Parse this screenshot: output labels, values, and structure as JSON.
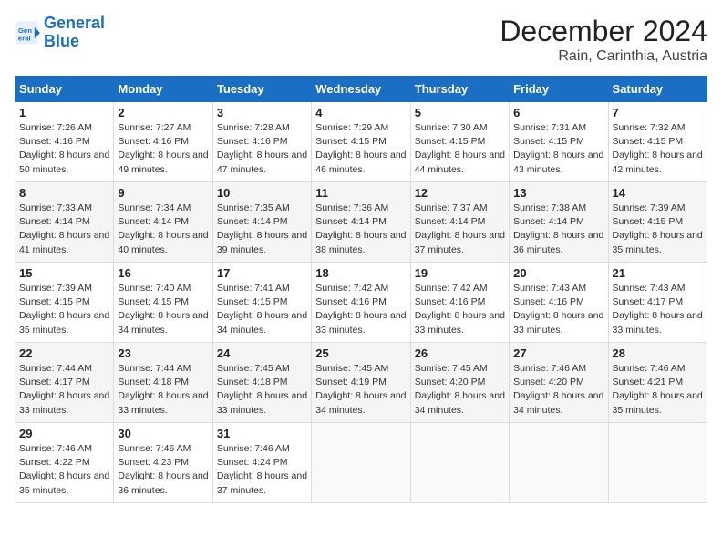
{
  "header": {
    "logo_line1": "General",
    "logo_line2": "Blue",
    "title": "December 2024",
    "subtitle": "Rain, Carinthia, Austria"
  },
  "weekdays": [
    "Sunday",
    "Monday",
    "Tuesday",
    "Wednesday",
    "Thursday",
    "Friday",
    "Saturday"
  ],
  "weeks": [
    [
      {
        "day": "1",
        "sunrise": "Sunrise: 7:26 AM",
        "sunset": "Sunset: 4:16 PM",
        "daylight": "Daylight: 8 hours and 50 minutes."
      },
      {
        "day": "2",
        "sunrise": "Sunrise: 7:27 AM",
        "sunset": "Sunset: 4:16 PM",
        "daylight": "Daylight: 8 hours and 49 minutes."
      },
      {
        "day": "3",
        "sunrise": "Sunrise: 7:28 AM",
        "sunset": "Sunset: 4:16 PM",
        "daylight": "Daylight: 8 hours and 47 minutes."
      },
      {
        "day": "4",
        "sunrise": "Sunrise: 7:29 AM",
        "sunset": "Sunset: 4:15 PM",
        "daylight": "Daylight: 8 hours and 46 minutes."
      },
      {
        "day": "5",
        "sunrise": "Sunrise: 7:30 AM",
        "sunset": "Sunset: 4:15 PM",
        "daylight": "Daylight: 8 hours and 44 minutes."
      },
      {
        "day": "6",
        "sunrise": "Sunrise: 7:31 AM",
        "sunset": "Sunset: 4:15 PM",
        "daylight": "Daylight: 8 hours and 43 minutes."
      },
      {
        "day": "7",
        "sunrise": "Sunrise: 7:32 AM",
        "sunset": "Sunset: 4:15 PM",
        "daylight": "Daylight: 8 hours and 42 minutes."
      }
    ],
    [
      {
        "day": "8",
        "sunrise": "Sunrise: 7:33 AM",
        "sunset": "Sunset: 4:14 PM",
        "daylight": "Daylight: 8 hours and 41 minutes."
      },
      {
        "day": "9",
        "sunrise": "Sunrise: 7:34 AM",
        "sunset": "Sunset: 4:14 PM",
        "daylight": "Daylight: 8 hours and 40 minutes."
      },
      {
        "day": "10",
        "sunrise": "Sunrise: 7:35 AM",
        "sunset": "Sunset: 4:14 PM",
        "daylight": "Daylight: 8 hours and 39 minutes."
      },
      {
        "day": "11",
        "sunrise": "Sunrise: 7:36 AM",
        "sunset": "Sunset: 4:14 PM",
        "daylight": "Daylight: 8 hours and 38 minutes."
      },
      {
        "day": "12",
        "sunrise": "Sunrise: 7:37 AM",
        "sunset": "Sunset: 4:14 PM",
        "daylight": "Daylight: 8 hours and 37 minutes."
      },
      {
        "day": "13",
        "sunrise": "Sunrise: 7:38 AM",
        "sunset": "Sunset: 4:14 PM",
        "daylight": "Daylight: 8 hours and 36 minutes."
      },
      {
        "day": "14",
        "sunrise": "Sunrise: 7:39 AM",
        "sunset": "Sunset: 4:15 PM",
        "daylight": "Daylight: 8 hours and 35 minutes."
      }
    ],
    [
      {
        "day": "15",
        "sunrise": "Sunrise: 7:39 AM",
        "sunset": "Sunset: 4:15 PM",
        "daylight": "Daylight: 8 hours and 35 minutes."
      },
      {
        "day": "16",
        "sunrise": "Sunrise: 7:40 AM",
        "sunset": "Sunset: 4:15 PM",
        "daylight": "Daylight: 8 hours and 34 minutes."
      },
      {
        "day": "17",
        "sunrise": "Sunrise: 7:41 AM",
        "sunset": "Sunset: 4:15 PM",
        "daylight": "Daylight: 8 hours and 34 minutes."
      },
      {
        "day": "18",
        "sunrise": "Sunrise: 7:42 AM",
        "sunset": "Sunset: 4:16 PM",
        "daylight": "Daylight: 8 hours and 33 minutes."
      },
      {
        "day": "19",
        "sunrise": "Sunrise: 7:42 AM",
        "sunset": "Sunset: 4:16 PM",
        "daylight": "Daylight: 8 hours and 33 minutes."
      },
      {
        "day": "20",
        "sunrise": "Sunrise: 7:43 AM",
        "sunset": "Sunset: 4:16 PM",
        "daylight": "Daylight: 8 hours and 33 minutes."
      },
      {
        "day": "21",
        "sunrise": "Sunrise: 7:43 AM",
        "sunset": "Sunset: 4:17 PM",
        "daylight": "Daylight: 8 hours and 33 minutes."
      }
    ],
    [
      {
        "day": "22",
        "sunrise": "Sunrise: 7:44 AM",
        "sunset": "Sunset: 4:17 PM",
        "daylight": "Daylight: 8 hours and 33 minutes."
      },
      {
        "day": "23",
        "sunrise": "Sunrise: 7:44 AM",
        "sunset": "Sunset: 4:18 PM",
        "daylight": "Daylight: 8 hours and 33 minutes."
      },
      {
        "day": "24",
        "sunrise": "Sunrise: 7:45 AM",
        "sunset": "Sunset: 4:18 PM",
        "daylight": "Daylight: 8 hours and 33 minutes."
      },
      {
        "day": "25",
        "sunrise": "Sunrise: 7:45 AM",
        "sunset": "Sunset: 4:19 PM",
        "daylight": "Daylight: 8 hours and 34 minutes."
      },
      {
        "day": "26",
        "sunrise": "Sunrise: 7:45 AM",
        "sunset": "Sunset: 4:20 PM",
        "daylight": "Daylight: 8 hours and 34 minutes."
      },
      {
        "day": "27",
        "sunrise": "Sunrise: 7:46 AM",
        "sunset": "Sunset: 4:20 PM",
        "daylight": "Daylight: 8 hours and 34 minutes."
      },
      {
        "day": "28",
        "sunrise": "Sunrise: 7:46 AM",
        "sunset": "Sunset: 4:21 PM",
        "daylight": "Daylight: 8 hours and 35 minutes."
      }
    ],
    [
      {
        "day": "29",
        "sunrise": "Sunrise: 7:46 AM",
        "sunset": "Sunset: 4:22 PM",
        "daylight": "Daylight: 8 hours and 35 minutes."
      },
      {
        "day": "30",
        "sunrise": "Sunrise: 7:46 AM",
        "sunset": "Sunset: 4:23 PM",
        "daylight": "Daylight: 8 hours and 36 minutes."
      },
      {
        "day": "31",
        "sunrise": "Sunrise: 7:46 AM",
        "sunset": "Sunset: 4:24 PM",
        "daylight": "Daylight: 8 hours and 37 minutes."
      },
      null,
      null,
      null,
      null
    ]
  ]
}
